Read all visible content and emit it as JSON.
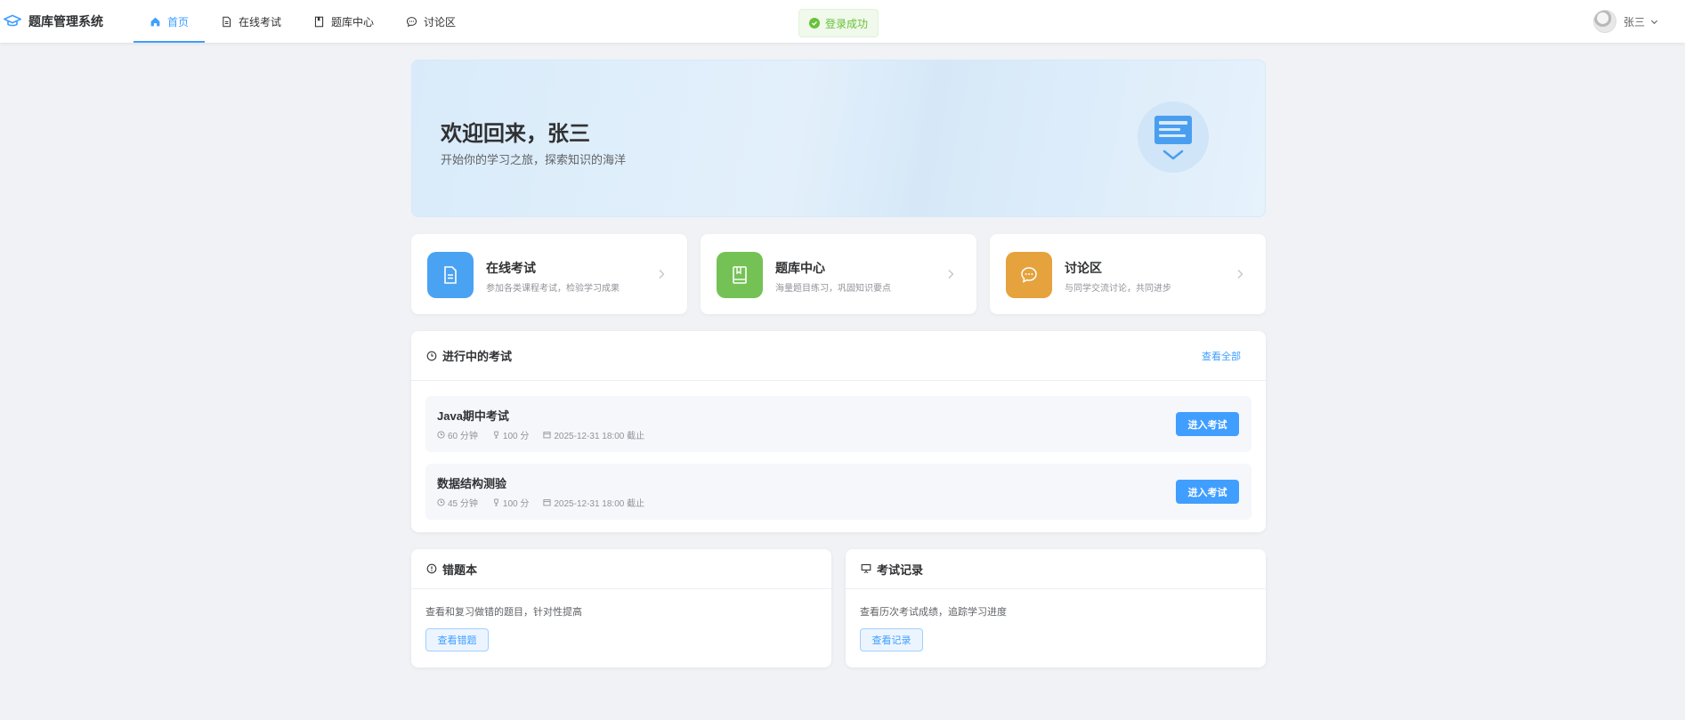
{
  "app": {
    "title": "题库管理系统"
  },
  "nav": {
    "items": [
      {
        "label": "首页",
        "icon": "home-icon",
        "active": true
      },
      {
        "label": "在线考试",
        "icon": "document-icon"
      },
      {
        "label": "题库中心",
        "icon": "book-icon"
      },
      {
        "label": "讨论区",
        "icon": "chat-icon"
      }
    ]
  },
  "toast": {
    "message": "登录成功",
    "color": "#67c23a"
  },
  "user": {
    "name": "张三"
  },
  "banner": {
    "title": "欢迎回来，张三",
    "subtitle": "开始你的学习之旅，探索知识的海洋"
  },
  "quick_links": [
    {
      "title": "在线考试",
      "desc": "参加各类课程考试，检验学习成果",
      "icon": "document-icon",
      "color": "#4aa2f3"
    },
    {
      "title": "题库中心",
      "desc": "海量题目练习，巩固知识要点",
      "icon": "book-icon",
      "color": "#74c255"
    },
    {
      "title": "讨论区",
      "desc": "与同学交流讨论，共同进步",
      "icon": "chat-icon",
      "color": "#e6a23c"
    }
  ],
  "ongoing_exams": {
    "title": "进行中的考试",
    "view_all": "查看全部",
    "items": [
      {
        "name": "Java期中考试",
        "duration": "60 分钟",
        "score": "100 分",
        "deadline": "2025-12-31 18:00 截止",
        "button": "进入考试"
      },
      {
        "name": "数据结构测验",
        "duration": "45 分钟",
        "score": "100 分",
        "deadline": "2025-12-31 18:00 截止",
        "button": "进入考试"
      }
    ]
  },
  "wrong_book": {
    "title": "错题本",
    "desc": "查看和复习做错的题目，针对性提高",
    "button": "查看错题"
  },
  "exam_records": {
    "title": "考试记录",
    "desc": "查看历次考试成绩，追踪学习进度",
    "button": "查看记录"
  },
  "colors": {
    "primary": "#409eff",
    "background": "#f0f2f5",
    "success": "#67c23a"
  }
}
